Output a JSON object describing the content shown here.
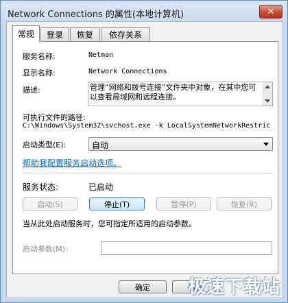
{
  "window": {
    "title": "Network Connections 的属性(本地计算机)",
    "close_label": "✕"
  },
  "tabs": [
    {
      "label": "常规",
      "active": true
    },
    {
      "label": "登录",
      "active": false
    },
    {
      "label": "恢复",
      "active": false
    },
    {
      "label": "依存关系",
      "active": false
    }
  ],
  "general": {
    "service_name_label": "服务名称:",
    "service_name_value": "Netman",
    "display_name_label": "显示名称:",
    "display_name_value": "Network Connections",
    "description_label": "描述:",
    "description_value": "管理“网络和拨号连接”文件夹中对象，在其中您可以查看局域网和远程连接。",
    "exe_path_label": "可执行文件的路径:",
    "exe_path_value": "C:\\Windows\\System32\\svchost.exe -k LocalSystemNetworkRestric",
    "startup_type_label": "启动类型(E):",
    "startup_type_value": "自动",
    "help_link": "帮助我配置服务启动选项。",
    "service_status_label": "服务状态:",
    "service_status_value": "已启动",
    "start_button": "启动(S)",
    "stop_button": "停止(T)",
    "pause_button": "暂停(P)",
    "resume_button": "恢复(R)",
    "start_hint": "当从此处启动服务时，您可指定所适用的启动参数。",
    "start_params_label": "启动参数(M):",
    "start_params_value": ""
  },
  "footer": {
    "ok_button": "确定",
    "cancel_button": "取消"
  },
  "watermark": "极速下载站"
}
